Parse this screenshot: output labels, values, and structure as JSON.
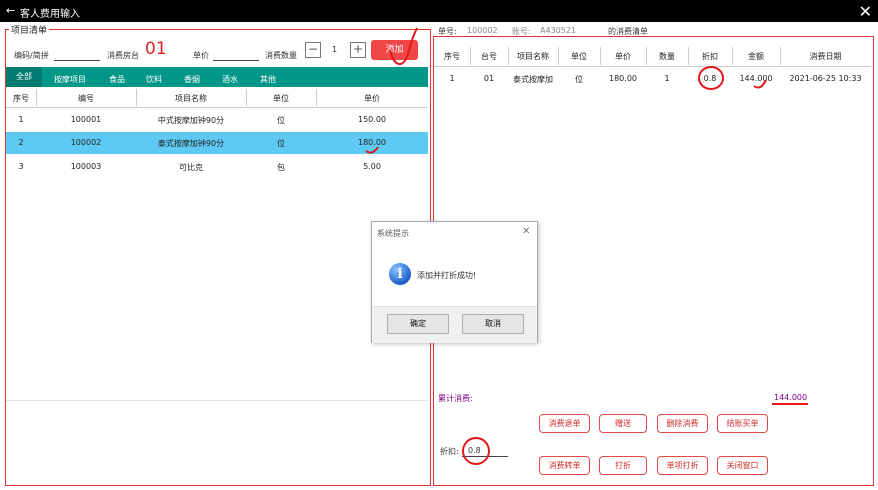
{
  "window": {
    "title": "客人费用输入",
    "back_icon": "←",
    "close_icon": "✕"
  },
  "left": {
    "legend": "项目清单",
    "code_label": "编码/简拼",
    "room_label": "消费房台",
    "room_value": "01",
    "price_label": "单价",
    "qty_label": "消费数量",
    "qty_value": "1",
    "minus": "−",
    "plus": "+",
    "add_button": "添加",
    "categories": [
      "全部",
      "按摩项目",
      "食品",
      "饮料",
      "香烟",
      "酒水",
      "其他"
    ],
    "columns": [
      "序号",
      "编号",
      "项目名称",
      "单位",
      "单价"
    ],
    "rows": [
      [
        "1",
        "100001",
        "中式按摩加钟90分",
        "位",
        "150.00"
      ],
      [
        "2",
        "100002",
        "泰式按摩加钟90分",
        "位",
        "180.00"
      ],
      [
        "3",
        "100003",
        "可比克",
        "包",
        "5.00"
      ]
    ],
    "selected_row": 1
  },
  "right": {
    "order_label": "单号:",
    "order_value": "100002",
    "account_label": "账号:",
    "account_value": "A430521",
    "list_title": "的消费清单",
    "columns": [
      "序号",
      "台号",
      "项目名称",
      "单位",
      "单价",
      "数量",
      "折扣",
      "金额",
      "消费日期"
    ],
    "rows": [
      [
        "1",
        "01",
        "泰式按摩加",
        "位",
        "180.00",
        "1",
        "0.8",
        "144.000",
        "2021-06-25 10:33"
      ]
    ],
    "total_label": "累计消费:",
    "total_value": "144.000",
    "discount_label": "折扣:",
    "discount_value": "0.8",
    "buttons_row1": [
      "消费退单",
      "赠送",
      "删除消费",
      "结账买单"
    ],
    "buttons_row2": [
      "消费转单",
      "打折",
      "单项打折",
      "关闭窗口"
    ]
  },
  "dialog": {
    "title": "系统提示",
    "close": "✕",
    "icon": "i",
    "message": "添加并打折成功!",
    "ok": "确定",
    "cancel": "取消"
  },
  "colors": {
    "accent": "#009688",
    "selected_row": "#5ecaf3",
    "add_button": "#f04646",
    "annotation": "#e01818",
    "total": "#800080"
  }
}
